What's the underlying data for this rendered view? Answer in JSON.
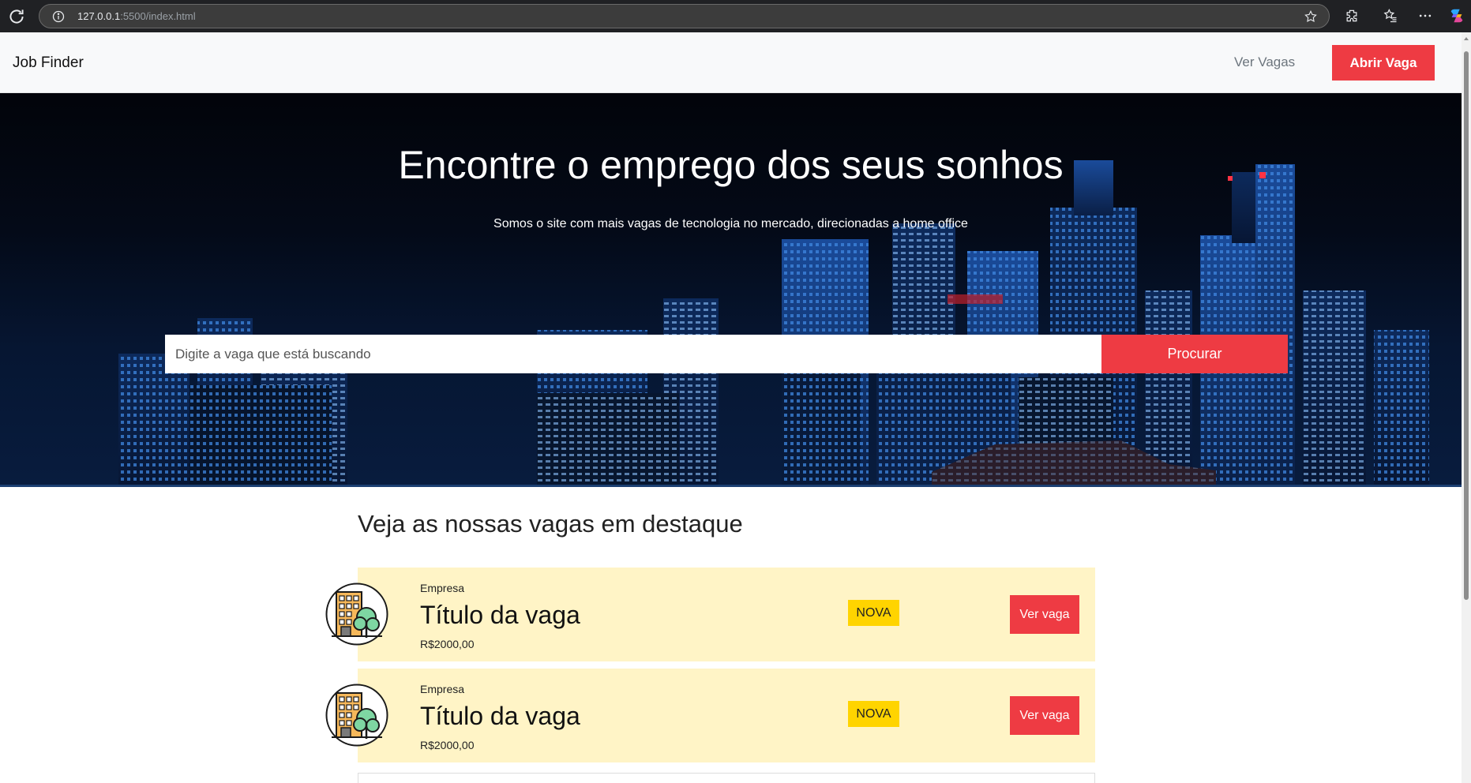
{
  "browser": {
    "url_host": "127.0.0.1",
    "url_rest": ":5500/index.html"
  },
  "navbar": {
    "brand": "Job Finder",
    "link_label": "Ver Vagas",
    "button_label": "Abrir Vaga"
  },
  "hero": {
    "title": "Encontre o emprego dos seus sonhos",
    "subtitle": "Somos o site com mais vagas de tecnologia no mercado, direcionadas a home office",
    "search_placeholder": "Digite a vaga que está buscando",
    "search_button": "Procurar"
  },
  "featured": {
    "title": "Veja as nossas vagas em destaque",
    "jobs": [
      {
        "company": "Empresa",
        "title": "Título da vaga",
        "salary": "R$2000,00",
        "badge": "NOVA",
        "button": "Ver vaga"
      },
      {
        "company": "Empresa",
        "title": "Título da vaga",
        "salary": "R$2000,00",
        "badge": "NOVA",
        "button": "Ver vaga"
      }
    ]
  },
  "colors": {
    "accent": "#ee3b43",
    "card_background": "#fff4c6",
    "badge": "#ffd400"
  },
  "icons": [
    "reload-icon",
    "info-icon",
    "star-icon",
    "extensions-icon",
    "favorites-icon",
    "more-icon",
    "copilot-icon",
    "company-building-icon"
  ]
}
